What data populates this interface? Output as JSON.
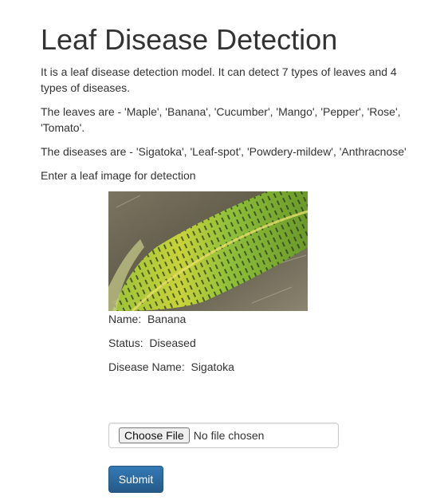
{
  "page": {
    "title": "Leaf Disease Detection",
    "intro": "It is a leaf disease detection model. It can detect 7 types of leaves and 4 types of diseases.",
    "leaves_line": "The leaves are - 'Maple', 'Banana', 'Cucumber', 'Mango', 'Pepper', 'Rose', 'Tomato'.",
    "diseases_line": "The diseases are - 'Sigatoka', 'Leaf-spot', 'Powdery-mildew', 'Anthracnose'",
    "prompt": "Enter a leaf image for detection"
  },
  "result": {
    "image_icon": "leaf-photo",
    "name_text": "Name:  Banana",
    "status_text": "Status:  Diseased",
    "disease_text": "Disease Name:  Sigatoka"
  },
  "form": {
    "choose_label": "Choose File",
    "file_status": "No file chosen",
    "submit_label": "Submit"
  },
  "colors": {
    "primary": "#337ab7",
    "text": "#333333"
  }
}
